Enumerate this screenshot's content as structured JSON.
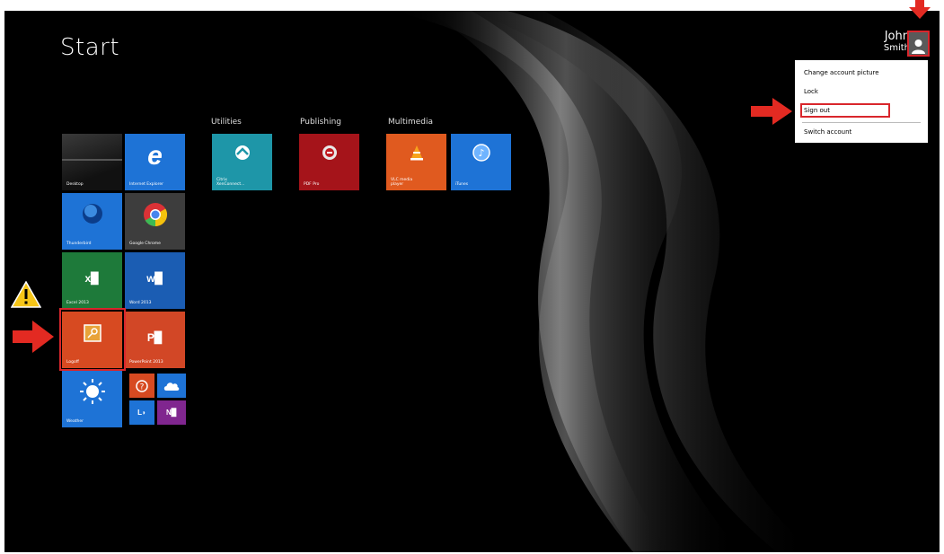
{
  "screen": {
    "title": "Start",
    "user": {
      "first": "John",
      "last": "Smith"
    }
  },
  "account_menu": {
    "items": [
      "Change account picture",
      "Lock",
      "Sign out",
      "Switch account"
    ]
  },
  "groups": {
    "utilities": "Utilities",
    "publishing": "Publishing",
    "multimedia": "Multimedia"
  },
  "tiles": {
    "desktop": "Desktop",
    "ie": "Internet Explorer",
    "thunder": "Thunderbird",
    "chrome": "Google Chrome",
    "excel": "Excel 2013",
    "word": "Word 2013",
    "logoff": "Logoff",
    "powerpoint": "PowerPoint 2013",
    "weather": "Weather",
    "citrix": "Citrix\nXenConnect...",
    "pdf": "PDF Pro",
    "vlc": "VLC media\nplayer",
    "itunes": "iTunes"
  },
  "colors": {
    "red_highlight": "#d9262c",
    "arrow": "#e32a22",
    "blue_tile": "#1e73d6",
    "orange_tile": "#d74a21",
    "green_tile": "#1e7a3a",
    "teal_tile": "#1e96a8",
    "dark_red_tile": "#a5141a"
  }
}
